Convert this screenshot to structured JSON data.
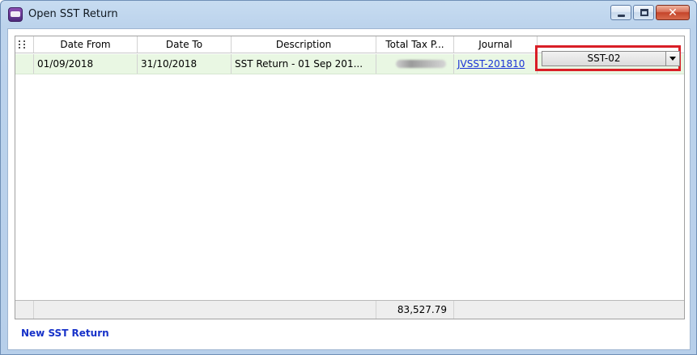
{
  "window": {
    "title": "Open SST Return"
  },
  "grid": {
    "columns": [
      "Date From",
      "Date To",
      "Description",
      "Total Tax P...",
      "Journal",
      ""
    ],
    "rows": [
      {
        "date_from": "01/09/2018",
        "date_to": "31/10/2018",
        "description": "SST Return - 01 Sep 201...",
        "journal": "JVSST-201810",
        "form_type": "SST-02"
      }
    ],
    "footer_total": "83,527.79"
  },
  "actions": {
    "new_label": "New SST Return"
  },
  "colors": {
    "row_selected": "#e9f7e3",
    "highlight_box": "#d91f26",
    "link": "#1a33d6"
  },
  "icons": {
    "app": "app-logo-icon",
    "indicator": "column-chooser-icon",
    "dropdown": "chevron-down-icon"
  }
}
